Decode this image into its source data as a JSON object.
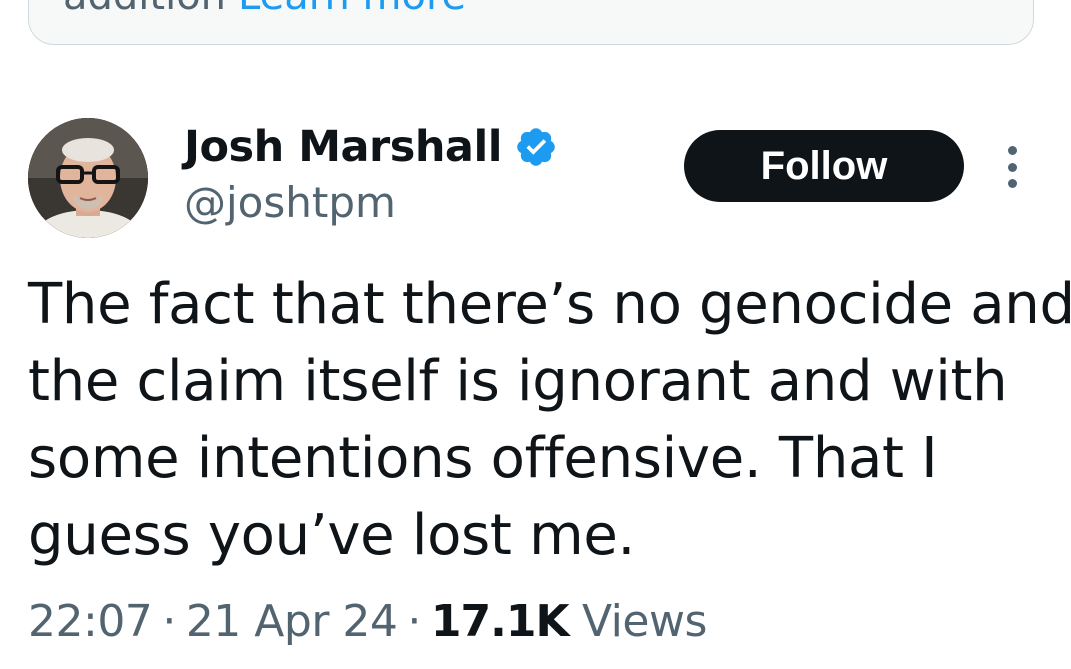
{
  "context_card": {
    "text": "addition",
    "link": "Learn more"
  },
  "author": {
    "display_name": "Josh Marshall",
    "handle": "@joshtpm",
    "verified_icon": "verified-badge-icon",
    "verified_color": "#1d9bf0"
  },
  "actions": {
    "follow_label": "Follow",
    "more_icon": "more-vertical-icon"
  },
  "tweet": {
    "lines": [
      "The fact that there’s no genocide and",
      "the claim itself is ignorant and with",
      "some intentions offensive. That I",
      "guess you’ve lost me."
    ]
  },
  "meta": {
    "time": "22:07",
    "separator": "·",
    "date": "21 Apr 24",
    "views_count": "17.1K",
    "views_label": "Views"
  },
  "colors": {
    "text_primary": "#0f1419",
    "text_secondary": "#536471",
    "accent": "#1d9bf0",
    "button_bg": "#0f1419"
  }
}
